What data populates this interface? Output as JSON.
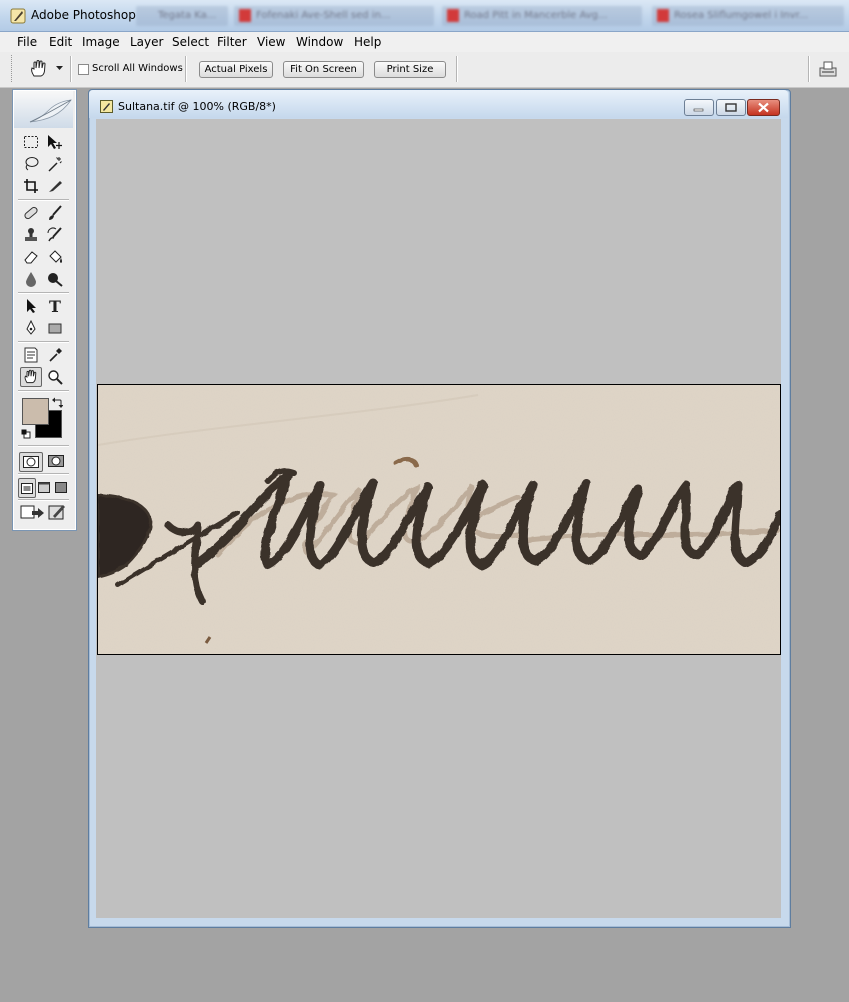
{
  "app": {
    "title": "Adobe Photoshop"
  },
  "taskbar_tabs": [
    {
      "label": "Tegata Ka..."
    },
    {
      "label": "Fofenaki Ave-Shell sed in..."
    },
    {
      "label": "Road Pitt in Mancerble Avg..."
    },
    {
      "label": "Rosea Sliflumgowel i Invr..."
    }
  ],
  "menu": {
    "items": [
      "File",
      "Edit",
      "Image",
      "Layer",
      "Select",
      "Filter",
      "View",
      "Window",
      "Help"
    ]
  },
  "options": {
    "scroll_all_windows": "Scroll All Windows",
    "scroll_all_checked": false,
    "actual_pixels": "Actual Pixels",
    "fit_on_screen": "Fit On Screen",
    "print_size": "Print Size"
  },
  "toolbox": {
    "tools": [
      "marquee-icon",
      "move-icon",
      "lasso-icon",
      "magic-wand-icon",
      "crop-icon",
      "slice-icon",
      "healing-brush-icon",
      "brush-icon",
      "clone-stamp-icon",
      "history-brush-icon",
      "eraser-icon",
      "paint-bucket-icon",
      "blur-icon",
      "dodge-icon",
      "path-selection-icon",
      "type-icon",
      "pen-icon",
      "rectangle-shape-icon",
      "notes-icon",
      "eyedropper-icon",
      "hand-icon",
      "zoom-icon"
    ],
    "selected_tool": "hand-icon",
    "type_glyph": "T",
    "foreground_color": "#cbbcac",
    "background_color": "#000000"
  },
  "document": {
    "title": "Sultana.tif @ 100% (RGB/8*)",
    "canvas_color": "#c0c0c0",
    "image_description_colors": {
      "paper": "#e1d8ca",
      "ink": "#3a2f28",
      "faded_ink": "#9c8068"
    }
  }
}
